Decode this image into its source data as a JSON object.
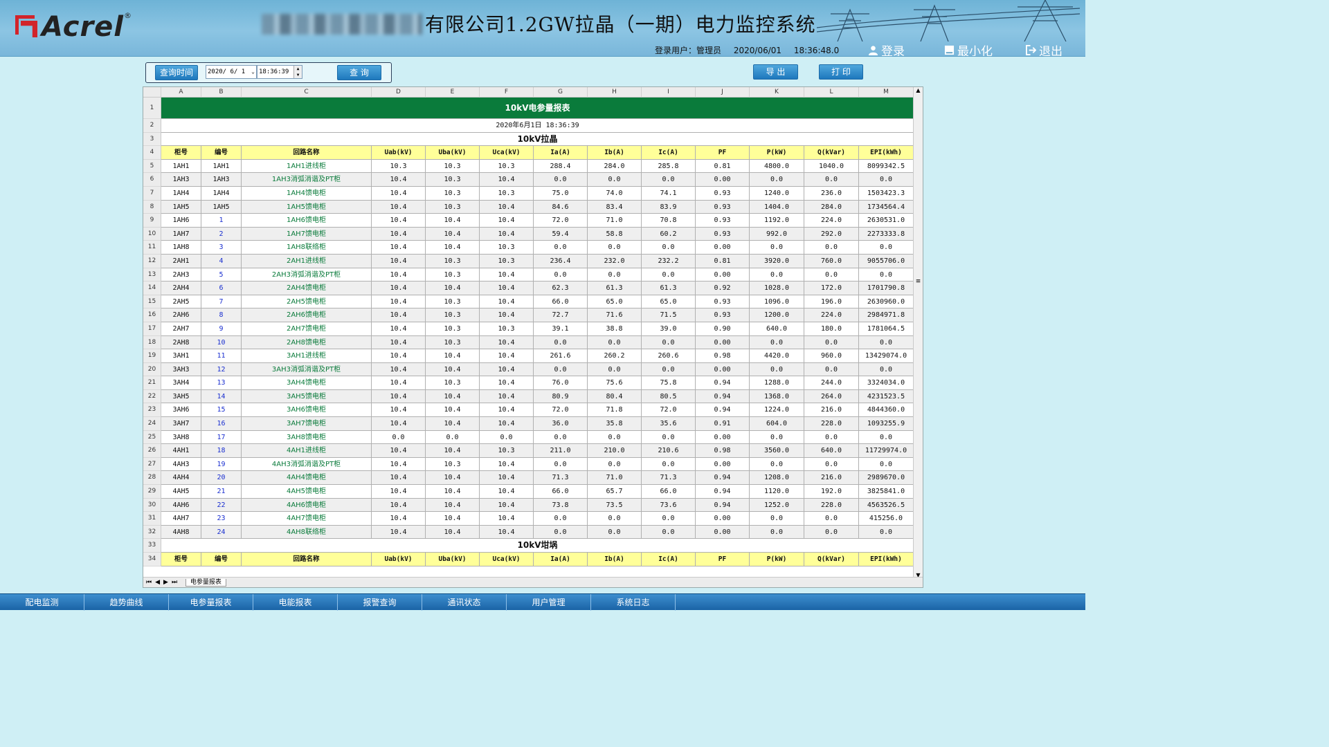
{
  "header": {
    "logo_text": "Acrel",
    "logo_mark": "®",
    "title": "有限公司1.2GW拉晶（一期）电力监控系统",
    "user_label": "登录用户：",
    "user_name": "管理员",
    "date": "2020/06/01",
    "time": "18:36:48.0",
    "login": "登录",
    "minimize": "最小化",
    "logout": "退出"
  },
  "query": {
    "label": "查询时间",
    "date_value": "2020/ 6/ 1",
    "time_value": "18:36:39",
    "search": "查 询",
    "export": "导 出",
    "print": "打 印"
  },
  "sheet": {
    "columns": [
      "A",
      "B",
      "C",
      "D",
      "E",
      "F",
      "G",
      "H",
      "I",
      "J",
      "K",
      "L",
      "M"
    ],
    "row_numbers": [
      "1",
      "2",
      "3",
      "4",
      "5",
      "6",
      "7",
      "8",
      "9",
      "10",
      "11",
      "12",
      "13",
      "14",
      "15",
      "16",
      "17",
      "18",
      "19",
      "20",
      "21",
      "22",
      "23",
      "24",
      "25",
      "26",
      "27",
      "28",
      "29",
      "30",
      "31",
      "32",
      "33",
      "34"
    ],
    "report_title": "10kV电参量报表",
    "report_time": "2020年6月1日 18:36:39",
    "section1": "10kV拉晶",
    "section2": "10kV坩埚",
    "headers": [
      "柜号",
      "编号",
      "回路名称",
      "Uab(kV)",
      "Uba(kV)",
      "Uca(kV)",
      "Ia(A)",
      "Ib(A)",
      "Ic(A)",
      "PF",
      "P(kW)",
      "Q(kVar)",
      "EPI(kWh)"
    ],
    "rows": [
      [
        "1AH1",
        "1AH1",
        "1AH1进线柜",
        "10.3",
        "10.3",
        "10.3",
        "288.4",
        "284.0",
        "285.8",
        "0.81",
        "4800.0",
        "1040.0",
        "8099342.5"
      ],
      [
        "1AH3",
        "1AH3",
        "1AH3消弧消谐及PT柜",
        "10.4",
        "10.3",
        "10.4",
        "0.0",
        "0.0",
        "0.0",
        "0.00",
        "0.0",
        "0.0",
        "0.0"
      ],
      [
        "1AH4",
        "1AH4",
        "1AH4馈电柜",
        "10.4",
        "10.3",
        "10.3",
        "75.0",
        "74.0",
        "74.1",
        "0.93",
        "1240.0",
        "236.0",
        "1503423.3"
      ],
      [
        "1AH5",
        "1AH5",
        "1AH5馈电柜",
        "10.4",
        "10.3",
        "10.4",
        "84.6",
        "83.4",
        "83.9",
        "0.93",
        "1404.0",
        "284.0",
        "1734564.4"
      ],
      [
        "1AH6",
        "1",
        "1AH6馈电柜",
        "10.4",
        "10.4",
        "10.4",
        "72.0",
        "71.0",
        "70.8",
        "0.93",
        "1192.0",
        "224.0",
        "2630531.0"
      ],
      [
        "1AH7",
        "2",
        "1AH7馈电柜",
        "10.4",
        "10.4",
        "10.4",
        "59.4",
        "58.8",
        "60.2",
        "0.93",
        "992.0",
        "292.0",
        "2273333.8"
      ],
      [
        "1AH8",
        "3",
        "1AH8联络柜",
        "10.4",
        "10.4",
        "10.3",
        "0.0",
        "0.0",
        "0.0",
        "0.00",
        "0.0",
        "0.0",
        "0.0"
      ],
      [
        "2AH1",
        "4",
        "2AH1进线柜",
        "10.4",
        "10.3",
        "10.3",
        "236.4",
        "232.0",
        "232.2",
        "0.81",
        "3920.0",
        "760.0",
        "9055706.0"
      ],
      [
        "2AH3",
        "5",
        "2AH3消弧消谐及PT柜",
        "10.4",
        "10.3",
        "10.4",
        "0.0",
        "0.0",
        "0.0",
        "0.00",
        "0.0",
        "0.0",
        "0.0"
      ],
      [
        "2AH4",
        "6",
        "2AH4馈电柜",
        "10.4",
        "10.4",
        "10.4",
        "62.3",
        "61.3",
        "61.3",
        "0.92",
        "1028.0",
        "172.0",
        "1701790.8"
      ],
      [
        "2AH5",
        "7",
        "2AH5馈电柜",
        "10.4",
        "10.3",
        "10.4",
        "66.0",
        "65.0",
        "65.0",
        "0.93",
        "1096.0",
        "196.0",
        "2630960.0"
      ],
      [
        "2AH6",
        "8",
        "2AH6馈电柜",
        "10.4",
        "10.3",
        "10.4",
        "72.7",
        "71.6",
        "71.5",
        "0.93",
        "1200.0",
        "224.0",
        "2984971.8"
      ],
      [
        "2AH7",
        "9",
        "2AH7馈电柜",
        "10.4",
        "10.3",
        "10.3",
        "39.1",
        "38.8",
        "39.0",
        "0.90",
        "640.0",
        "180.0",
        "1781064.5"
      ],
      [
        "2AH8",
        "10",
        "2AH8馈电柜",
        "10.4",
        "10.3",
        "10.4",
        "0.0",
        "0.0",
        "0.0",
        "0.00",
        "0.0",
        "0.0",
        "0.0"
      ],
      [
        "3AH1",
        "11",
        "3AH1进线柜",
        "10.4",
        "10.4",
        "10.4",
        "261.6",
        "260.2",
        "260.6",
        "0.98",
        "4420.0",
        "960.0",
        "13429074.0"
      ],
      [
        "3AH3",
        "12",
        "3AH3消弧消谐及PT柜",
        "10.4",
        "10.4",
        "10.4",
        "0.0",
        "0.0",
        "0.0",
        "0.00",
        "0.0",
        "0.0",
        "0.0"
      ],
      [
        "3AH4",
        "13",
        "3AH4馈电柜",
        "10.4",
        "10.3",
        "10.4",
        "76.0",
        "75.6",
        "75.8",
        "0.94",
        "1288.0",
        "244.0",
        "3324034.0"
      ],
      [
        "3AH5",
        "14",
        "3AH5馈电柜",
        "10.4",
        "10.4",
        "10.4",
        "80.9",
        "80.4",
        "80.5",
        "0.94",
        "1368.0",
        "264.0",
        "4231523.5"
      ],
      [
        "3AH6",
        "15",
        "3AH6馈电柜",
        "10.4",
        "10.4",
        "10.4",
        "72.0",
        "71.8",
        "72.0",
        "0.94",
        "1224.0",
        "216.0",
        "4844360.0"
      ],
      [
        "3AH7",
        "16",
        "3AH7馈电柜",
        "10.4",
        "10.4",
        "10.4",
        "36.0",
        "35.8",
        "35.6",
        "0.91",
        "604.0",
        "228.0",
        "1093255.9"
      ],
      [
        "3AH8",
        "17",
        "3AH8馈电柜",
        "0.0",
        "0.0",
        "0.0",
        "0.0",
        "0.0",
        "0.0",
        "0.00",
        "0.0",
        "0.0",
        "0.0"
      ],
      [
        "4AH1",
        "18",
        "4AH1进线柜",
        "10.4",
        "10.4",
        "10.3",
        "211.0",
        "210.0",
        "210.6",
        "0.98",
        "3560.0",
        "640.0",
        "11729974.0"
      ],
      [
        "4AH3",
        "19",
        "4AH3消弧消谐及PT柜",
        "10.4",
        "10.3",
        "10.4",
        "0.0",
        "0.0",
        "0.0",
        "0.00",
        "0.0",
        "0.0",
        "0.0"
      ],
      [
        "4AH4",
        "20",
        "4AH4馈电柜",
        "10.4",
        "10.4",
        "10.4",
        "71.3",
        "71.0",
        "71.3",
        "0.94",
        "1208.0",
        "216.0",
        "2989670.0"
      ],
      [
        "4AH5",
        "21",
        "4AH5馈电柜",
        "10.4",
        "10.4",
        "10.4",
        "66.0",
        "65.7",
        "66.0",
        "0.94",
        "1120.0",
        "192.0",
        "3825841.0"
      ],
      [
        "4AH6",
        "22",
        "4AH6馈电柜",
        "10.4",
        "10.4",
        "10.4",
        "73.8",
        "73.5",
        "73.6",
        "0.94",
        "1252.0",
        "228.0",
        "4563526.5"
      ],
      [
        "4AH7",
        "23",
        "4AH7馈电柜",
        "10.4",
        "10.4",
        "10.4",
        "0.0",
        "0.0",
        "0.0",
        "0.00",
        "0.0",
        "0.0",
        "415256.0"
      ],
      [
        "4AH8",
        "24",
        "4AH8联络柜",
        "10.4",
        "10.4",
        "10.4",
        "0.0",
        "0.0",
        "0.0",
        "0.00",
        "0.0",
        "0.0",
        "0.0"
      ]
    ],
    "sheet_tab": "电参量报表",
    "colors": {
      "title_bg": "#0a7b3b",
      "header_bg": "#ffff99",
      "name_color": "#0a7b3b",
      "num_color": "#1a2fd0"
    }
  },
  "nav": [
    "配电监测",
    "趋势曲线",
    "电参量报表",
    "电能报表",
    "报警查询",
    "通讯状态",
    "用户管理",
    "系统日志"
  ],
  "icons": {
    "login": "user-icon",
    "minimize": "minimize-icon",
    "logout": "logout-icon",
    "date_dropdown": "chevron-down-icon",
    "time_spinner": "spinner-icon"
  }
}
